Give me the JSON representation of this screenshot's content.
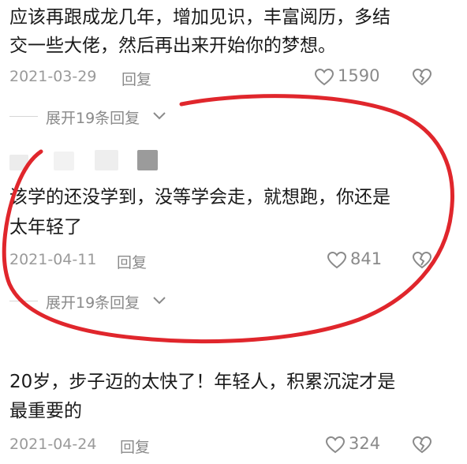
{
  "comments": [
    {
      "text_lines": [
        "应该再跟成龙几年，增加见识，丰富阅历，多结",
        "交一些大佬，然后再出来开始你的梦想。"
      ],
      "date": "2021-03-29",
      "reply_label": "回复",
      "likes": "1590",
      "expand_label": "展开19条回复"
    },
    {
      "text_lines": [
        "该学的还没学到，没等学会走，就想跑，你还是",
        "太年轻了"
      ],
      "date": "2021-04-11",
      "reply_label": "回复",
      "likes": "841",
      "expand_label": "展开19条回复"
    },
    {
      "text_lines": [
        "20岁，步子迈的太快了！年轻人，积累沉淀才是",
        "最重要的"
      ],
      "date": "2021-04-24",
      "reply_label": "回复",
      "likes": "324"
    }
  ],
  "colors": {
    "annotation_circle": "#e0262c",
    "meta_text": "#9a9a9a",
    "body_text": "#1a1a1a"
  },
  "icons": {
    "like": "heart-outline-icon",
    "dislike": "broken-heart-icon",
    "expand": "chevron-down-icon"
  }
}
